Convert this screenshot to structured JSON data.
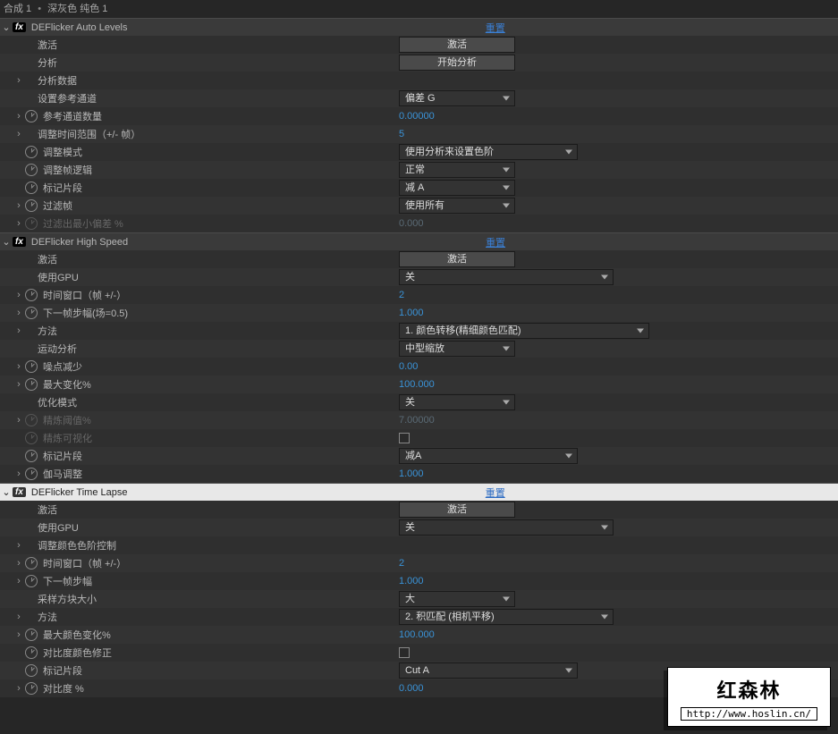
{
  "breadcrumb": {
    "a": "合成 1",
    "sep": "•",
    "b": "深灰色 纯色 1"
  },
  "reset_label": "重置",
  "effects": {
    "auto": {
      "title": "DEFlicker Auto Levels",
      "rows": {
        "activate": {
          "label": "激活",
          "btn": "激活"
        },
        "analysis": {
          "label": "分析",
          "btn": "开始分析"
        },
        "analysis_data": {
          "label": "分析数据"
        },
        "ref_channel": {
          "label": "设置参考通道",
          "value": "偏差 G"
        },
        "ref_count": {
          "label": "参考通道数量",
          "value": "0.00000"
        },
        "time_range": {
          "label": "调整时间范围（+/- 帧）",
          "value": "5"
        },
        "mode": {
          "label": "调整模式",
          "value": "使用分析来设置色阶"
        },
        "frame_logic": {
          "label": "调整帧逻辑",
          "value": "正常"
        },
        "mark": {
          "label": "标记片段",
          "value": "减 A"
        },
        "filter_frame": {
          "label": "过滤帧",
          "value": "使用所有"
        },
        "min_bias": {
          "label": "过滤出最小偏差 %",
          "value": "0.000"
        }
      }
    },
    "hs": {
      "title": "DEFlicker High Speed",
      "rows": {
        "activate": {
          "label": "激活",
          "btn": "激活"
        },
        "gpu": {
          "label": "使用GPU",
          "value": "关"
        },
        "time_window": {
          "label": "时间窗口（帧 +/-）",
          "value": "2"
        },
        "step": {
          "label": "下一帧步幅(场=0.5)",
          "value": "1.000"
        },
        "method": {
          "label": "方法",
          "value": "1. 颜色转移(精细颜色匹配)"
        },
        "motion": {
          "label": "运动分析",
          "value": "中型缩放"
        },
        "noise": {
          "label": "噪点减少",
          "value": "0.00"
        },
        "max_change": {
          "label": "最大变化%",
          "value": "100.000"
        },
        "opt_mode": {
          "label": "优化模式",
          "value": "关"
        },
        "refine_thresh": {
          "label": "精炼阈值%",
          "value": "7.00000"
        },
        "refine_viz": {
          "label": "精炼可视化"
        },
        "mark": {
          "label": "标记片段",
          "value": "减A"
        },
        "gamma": {
          "label": "伽马调整",
          "value": "1.000"
        }
      }
    },
    "tl": {
      "title": "DEFlicker Time Lapse",
      "rows": {
        "activate": {
          "label": "激活",
          "btn": "激活"
        },
        "gpu": {
          "label": "使用GPU",
          "value": "关"
        },
        "color_ctrl": {
          "label": "调整颜色色阶控制"
        },
        "time_window": {
          "label": "时间窗口（帧 +/-）",
          "value": "2"
        },
        "step": {
          "label": "下一帧步幅",
          "value": "1.000"
        },
        "sample": {
          "label": "采样方块大小",
          "value": "大"
        },
        "method": {
          "label": "方法",
          "value": "2. 积匹配 (相机平移)"
        },
        "max_color": {
          "label": "最大颜色变化%",
          "value": "100.000"
        },
        "contrast_fix": {
          "label": "对比度颜色修正"
        },
        "mark": {
          "label": "标记片段",
          "value": "Cut A"
        },
        "contrast": {
          "label": "对比度 %",
          "value": "0.000"
        }
      }
    }
  },
  "watermark": {
    "title": "红森林",
    "url": "http://www.hoslin.cn/"
  }
}
